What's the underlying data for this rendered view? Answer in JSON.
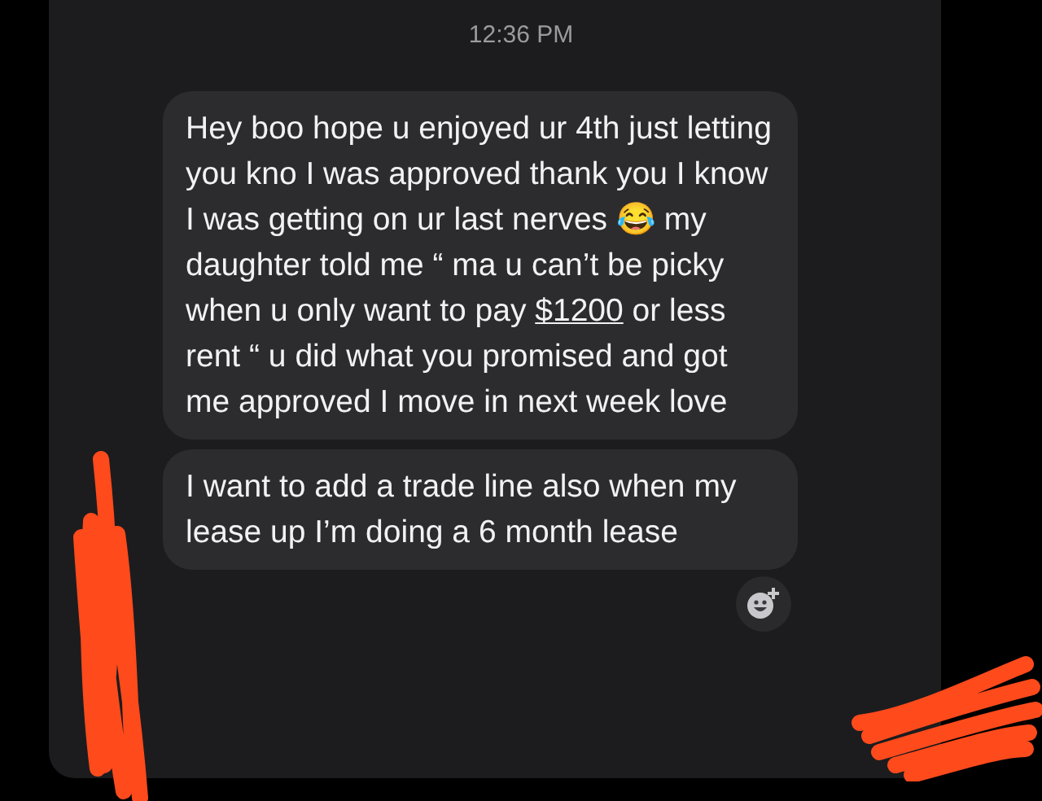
{
  "timestamp": "12:36 PM",
  "messages": [
    {
      "segments": [
        {
          "kind": "text",
          "text": "Hey boo hope u enjoyed ur 4th just letting you kno I was approved thank you I know I was getting on ur last nerves 😂 my daughter told me “ ma u can’t be picky when u only want to pay "
        },
        {
          "kind": "link",
          "text": "$1200"
        },
        {
          "kind": "text",
          "text": " or less rent “ u did what you promised and got me approved I move in next week love"
        }
      ]
    },
    {
      "segments": [
        {
          "kind": "text",
          "text": "I want to add a trade line also when my lease up I’m doing a 6 month lease"
        }
      ]
    }
  ]
}
